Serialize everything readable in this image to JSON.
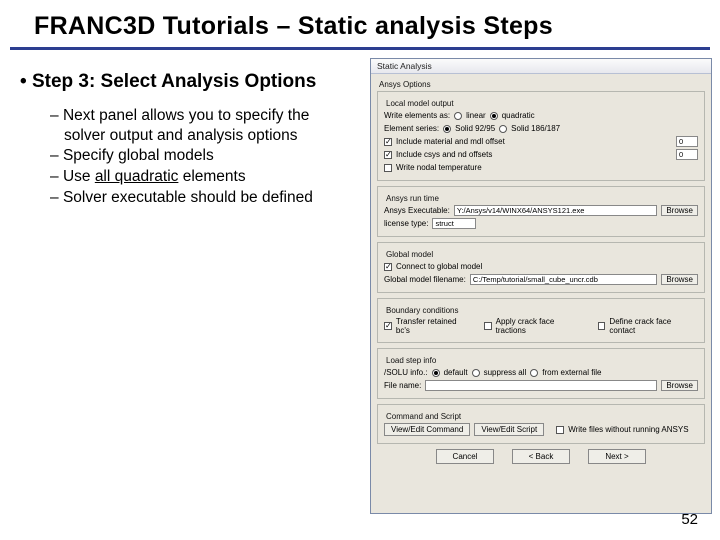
{
  "title": "FRANC3D Tutorials – Static analysis Steps",
  "step_heading_prefix": "•  ",
  "step_heading": "Step 3: Select Analysis Options",
  "bullets": [
    "Next panel allows you to specify the solver output and analysis options",
    "Specify global models",
    "Use all quadratic elements",
    "Solver executable should be defined"
  ],
  "bullet_underline_word": "all quadratic",
  "page_number": "52",
  "dialog": {
    "title": "Static Analysis",
    "top_label": "Ansys Options",
    "local_model": {
      "legend": "Local model output",
      "write_elements_label": "Write elements as:",
      "linear": "linear",
      "quadratic": "quadratic",
      "element_series_label": "Element series:",
      "solid9295": "Solid 92/95",
      "solid186187": "Solid 186/187",
      "include_material": "Include material and mdl offset",
      "mdl_value": "0",
      "include_csys": "Include csys and nd offsets",
      "csys_value": "0",
      "write_nodal_temp": "Write nodal temperature"
    },
    "runtime": {
      "legend": "Ansys run time",
      "exec_label": "Ansys Executable:",
      "exec_value": "Y:/Ansys/v14/WINX64/ANSYS121.exe",
      "browse": "Browse",
      "license_label": "license type:",
      "license_value": "struct"
    },
    "global_model": {
      "legend": "Global model",
      "connect": "Connect to global model",
      "filename_label": "Global model filename:",
      "filename_value": "C:/Temp/tutorial/small_cube_uncr.cdb",
      "browse": "Browse"
    },
    "boundary": {
      "legend": "Boundary conditions",
      "transfer": "Transfer retained bc's",
      "apply_crack": "Apply crack face tractions",
      "define_contact": "Define crack face contact"
    },
    "loadstep": {
      "legend": "Load step info",
      "solu_label": "/SOLU info.:",
      "default": "default",
      "suppress": "suppress all",
      "external": "from external file",
      "filename_label": "File name:",
      "browse": "Browse"
    },
    "command_script": {
      "legend": "Command and Script",
      "view_edit_cmd": "View/Edit Command",
      "view_edit_script": "View/Edit Script",
      "write_files": "Write files without running ANSYS"
    },
    "buttons": {
      "cancel": "Cancel",
      "back": "<   Back",
      "next": "Next   >"
    }
  }
}
